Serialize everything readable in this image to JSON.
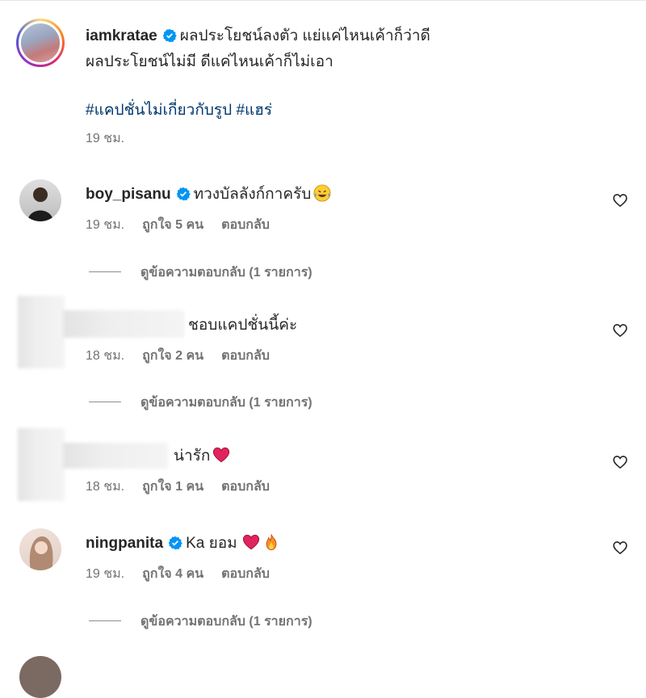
{
  "caption": {
    "username": "iamkratae",
    "line1": "ผลประโยชน์ลงตัว แย่แค่ไหนเค้าก็ว่าดี",
    "line2": "ผลประโยชน์ไม่มี ดีแค่ไหนเค้าก็ไม่เอา",
    "hashtags": "#แคปชั่นไม่เกี่ยวกับรูป #แฮร่",
    "time": "19 ชม."
  },
  "comments": [
    {
      "username": "boy_pisanu",
      "verified": true,
      "text": "ทวงบัลลังก์กาครับ",
      "time": "19 ชม.",
      "likes": "ถูกใจ 5 คน",
      "reply": "ตอบกลับ",
      "view_replies": "ดูข้อความตอบกลับ (1 รายการ)"
    },
    {
      "username": "",
      "verified": false,
      "text": "ชอบแคปชั่นนี้ค่ะ",
      "time": "18 ชม.",
      "likes": "ถูกใจ 2 คน",
      "reply": "ตอบกลับ",
      "view_replies": "ดูข้อความตอบกลับ (1 รายการ)"
    },
    {
      "username": "",
      "verified": false,
      "text": "น่ารัก",
      "time": "18 ชม.",
      "likes": "ถูกใจ 1 คน",
      "reply": "ตอบกลับ"
    },
    {
      "username": "ningpanita",
      "verified": true,
      "text": "Ka ยอม",
      "time": "19 ชม.",
      "likes": "ถูกใจ 4 คน",
      "reply": "ตอบกลับ",
      "view_replies": "ดูข้อความตอบกลับ (1 รายการ)"
    }
  ],
  "colors": {
    "text": "#262626",
    "meta": "#737373",
    "hashtag": "#00376b",
    "verified": "#0095f6",
    "heart_red": "#e0245e"
  }
}
